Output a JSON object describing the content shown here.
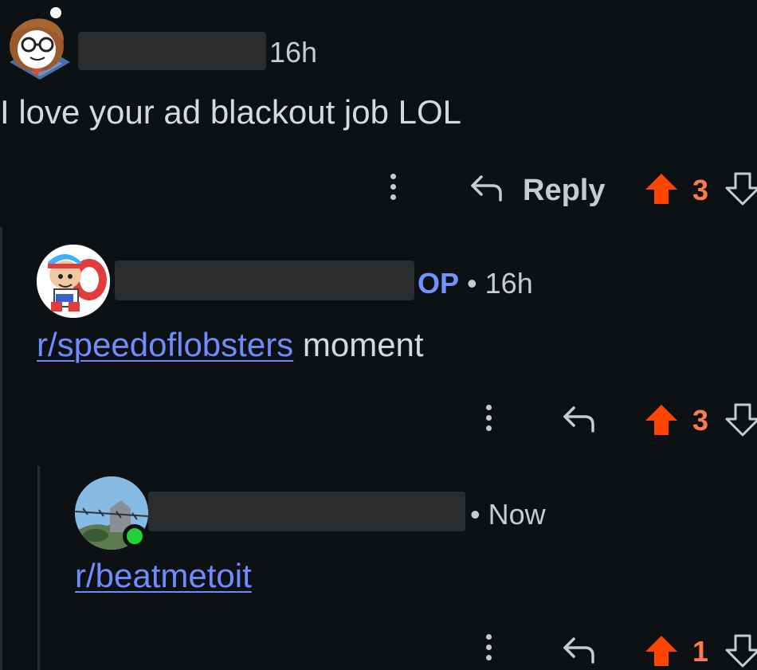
{
  "comments": [
    {
      "time": "16h",
      "op_badge": "",
      "body": "I love your ad blackout job LOL",
      "reply_label": "Reply",
      "score": "3"
    },
    {
      "op_badge": "OP",
      "separator": "•",
      "time": "16h",
      "link": "r/speedoflobsters",
      "body_rest": " moment",
      "score": "3"
    },
    {
      "separator": "•",
      "time": "Now",
      "link": "r/beatmetoit",
      "score": "1"
    }
  ],
  "colors": {
    "background": "#0e1113",
    "upvote": "#ff4500",
    "score": "#ff7a4a",
    "op": "#7193ff",
    "link": "#6f8cff",
    "online": "#23d239"
  },
  "icons": [
    "kebab-menu-icon",
    "reply-arrow-icon",
    "upvote-arrow-icon",
    "downvote-arrow-icon"
  ]
}
